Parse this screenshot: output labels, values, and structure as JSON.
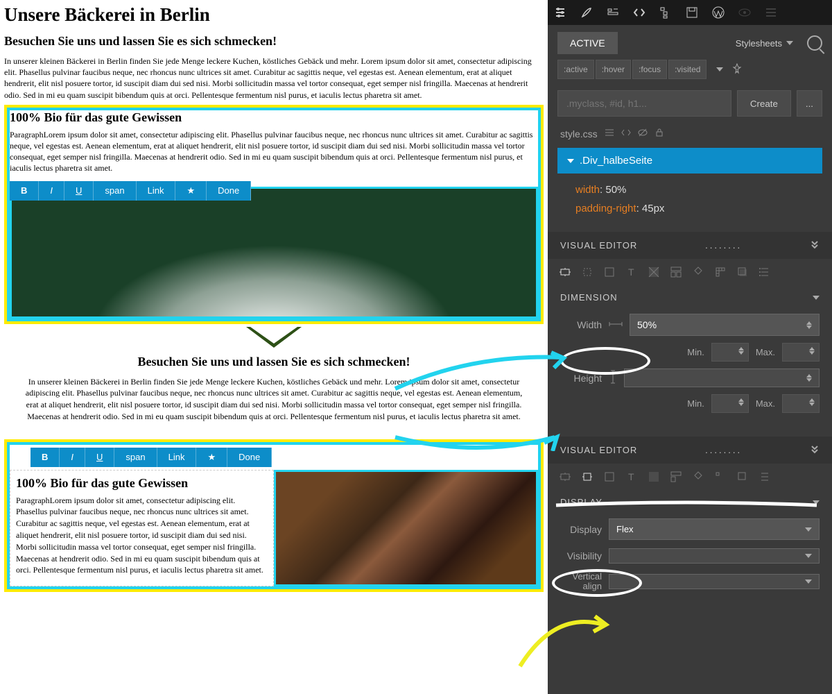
{
  "page": {
    "title": "Unsere Bäckerei in Berlin",
    "subtitle": "Besuchen Sie uns und lassen Sie es sich schmecken!",
    "intro": "In unserer kleinen Bäckerei in Berlin finden Sie jede Menge leckere Kuchen, köstliches Gebäck und mehr.  Lorem ipsum dolor sit amet, consectetur adipiscing elit. Phasellus pulvinar faucibus neque, nec rhoncus nunc ultrices sit amet. Curabitur ac sagittis neque, vel egestas est. Aenean elementum, erat at aliquet hendrerit, elit nisl posuere tortor, id suscipit diam dui sed nisi. Morbi sollicitudin massa vel tortor consequat, eget semper nisl fringilla. Maecenas at hendrerit odio. Sed in mi eu quam suscipit bibendum quis at orci. Pellentesque fermentum nisl purus, et iaculis lectus pharetra sit amet.",
    "bio_heading": "100% Bio für das gute Gewissen",
    "bio_text": "ParagraphLorem ipsum dolor sit amet, consectetur adipiscing elit. Phasellus pulvinar faucibus neque, nec rhoncus nunc ultrices sit amet. Curabitur ac sagittis neque, vel egestas est. Aenean elementum, erat at aliquet hendrerit, elit nisl posuere tortor, id suscipit diam dui sed nisi. Morbi sollicitudin massa vel tortor consequat, eget semper nisl fringilla. Maecenas at hendrerit odio. Sed in mi eu quam suscipit bibendum quis at orci. Pellentesque fermentum nisl purus, et iaculis lectus pharetra sit amet.",
    "centered_heading": "Besuchen Sie uns und lassen Sie es sich schmecken!",
    "centered_text": "In unserer kleinen Bäckerei in Berlin finden Sie jede Menge leckere Kuchen, köstliches Gebäck und mehr.  Lorem ipsum dolor sit amet, consectetur adipiscing elit. Phasellus pulvinar faucibus neque, nec rhoncus nunc ultrices sit amet. Curabitur ac sagittis neque, vel egestas est. Aenean elementum, erat at aliquet hendrerit, elit nisl posuere tortor, id suscipit diam dui sed nisi. Morbi sollicitudin massa vel tortor consequat, eget semper nisl fringilla. Maecenas at hendrerit odio. Sed in mi eu quam suscipit bibendum quis at orci. Pellentesque fermentum nisl purus, et iaculis lectus pharetra sit amet.",
    "flex_heading": "100% Bio für das gute Gewissen",
    "flex_text": "ParagraphLorem ipsum dolor sit amet, consectetur adipiscing elit. Phasellus pulvinar faucibus neque, nec rhoncus nunc ultrices sit amet. Curabitur ac sagittis neque, vel egestas est. Aenean elementum, erat at aliquet hendrerit, elit nisl posuere tortor, id suscipit diam dui sed nisi. Morbi sollicitudin massa vel tortor consequat, eget semper nisl fringilla. Maecenas at hendrerit odio. Sed in mi eu quam suscipit bibendum quis at orci. Pellentesque fermentum nisl purus, et iaculis lectus pharetra sit amet."
  },
  "toolbar": {
    "bold": "B",
    "italic": "I",
    "underline": "U",
    "span": "span",
    "link": "Link",
    "star": "★",
    "done": "Done"
  },
  "sidebar": {
    "tab_active": "ACTIVE",
    "tab_stylesheets": "Stylesheets",
    "pseudo": [
      ":active",
      ":hover",
      ":focus",
      ":visited"
    ],
    "selector_placeholder": ".myclass, #id, h1...",
    "create_btn": "Create",
    "dots": "...",
    "css_file": "style.css",
    "selector": ".Div_halbeSeite",
    "props": [
      {
        "name": "width",
        "value": "50%"
      },
      {
        "name": "padding-right",
        "value": "45px"
      }
    ],
    "visual_editor": "VISUAL EDITOR",
    "dimension_header": "DIMENSION",
    "width_label": "Width",
    "width_value": "50%",
    "min_label": "Min.",
    "max_label": "Max.",
    "height_label": "Height",
    "display_header": "DISPLAY",
    "display_label": "Display",
    "display_value": "Flex",
    "visibility_label": "Visibility",
    "valign_label": "Vertical align",
    "dots_indicator": "........"
  }
}
